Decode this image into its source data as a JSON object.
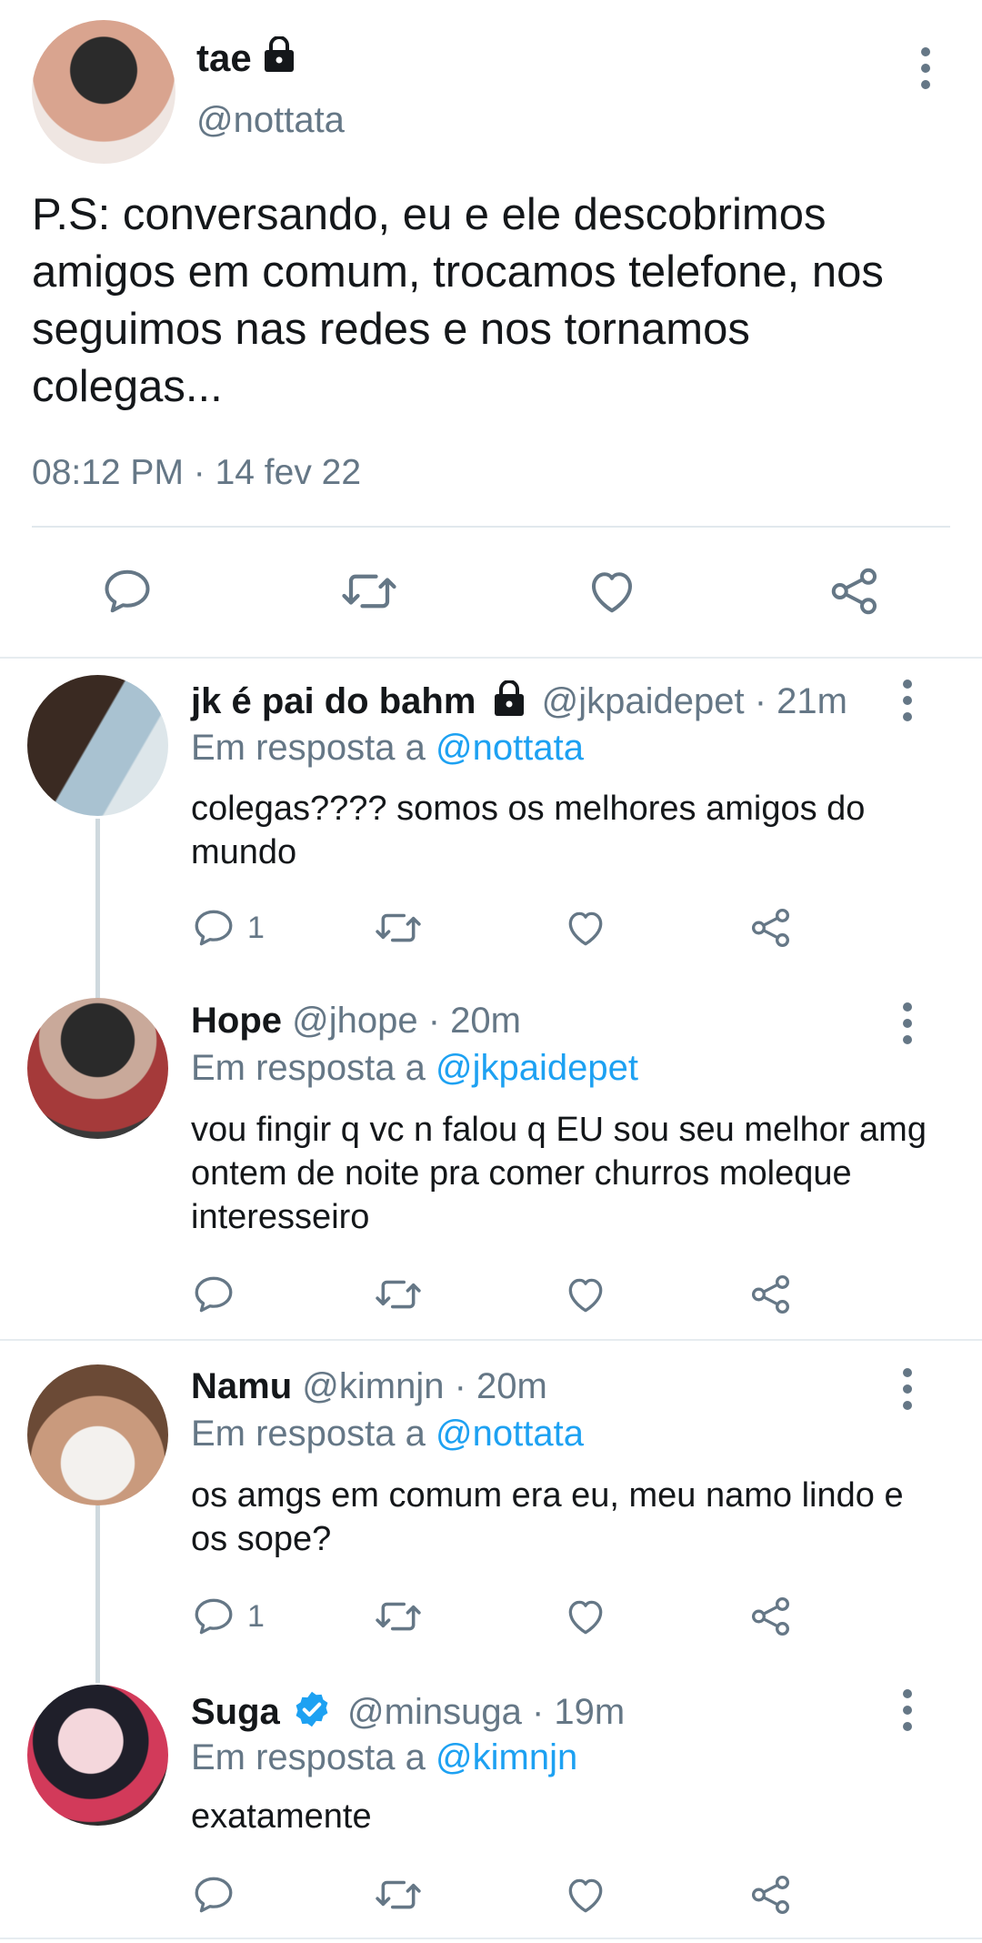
{
  "main_tweet": {
    "name": "tae",
    "handle": "@nottata",
    "text": "P.S: conversando, eu e ele descobrimos amigos em comum, trocamos telefone, nos seguimos nas redes e nos tornamos colegas...",
    "timestamp": "08:12 PM · 14 fev 22"
  },
  "replies": [
    {
      "name": "jk é pai do bahm",
      "handle": "@jkpaidepet",
      "time": "· 21m",
      "in_reply_label": "Em resposta a",
      "in_reply_to": "@nottata",
      "text": "colegas???? somos os melhores amigos do mundo",
      "reply_count": "1"
    },
    {
      "name": "Hope",
      "handle": "@jhope",
      "time": "· 20m",
      "in_reply_label": "Em resposta a",
      "in_reply_to": "@jkpaidepet",
      "text": "vou fingir q vc n falou q EU sou seu melhor amg ontem de noite pra comer churros moleque interesseiro",
      "reply_count": ""
    },
    {
      "name": "Namu",
      "handle": "@kimnjn",
      "time": "· 20m",
      "in_reply_label": "Em resposta a",
      "in_reply_to": "@nottata",
      "text": "os amgs em comum era eu, meu namo lindo e os sope?",
      "reply_count": "1"
    },
    {
      "name": "Suga",
      "handle": "@minsuga",
      "time": "· 19m",
      "in_reply_label": "Em resposta a",
      "in_reply_to": "@kimnjn",
      "text": "exatamente",
      "reply_count": ""
    }
  ],
  "colors": {
    "link": "#1da1f2",
    "muted": "#657786",
    "verified": "#1da1f2"
  }
}
